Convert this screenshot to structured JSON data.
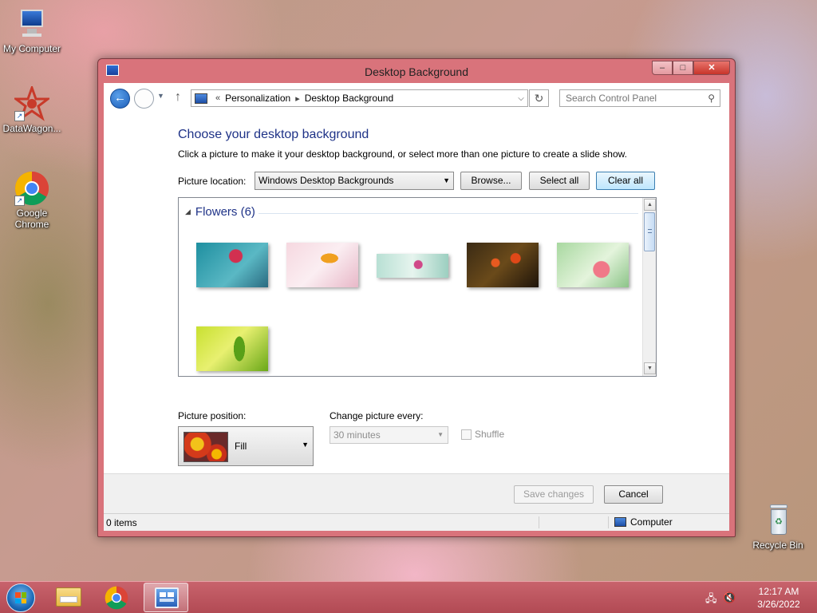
{
  "desktop": {
    "icons": [
      {
        "label": "My Computer",
        "icon": "computer-icon"
      },
      {
        "label": "DataWagon...",
        "icon": "datawagon-icon"
      },
      {
        "label": "Google Chrome",
        "icon": "chrome-icon"
      },
      {
        "label": "Recycle Bin",
        "icon": "recycle-bin-icon"
      }
    ]
  },
  "window": {
    "title": "Desktop Background",
    "controls": {
      "minimize": "‒",
      "maximize": "□",
      "close": "✕"
    }
  },
  "nav": {
    "breadcrumb_prefix": "«",
    "breadcrumbs": [
      "Personalization",
      "Desktop Background"
    ],
    "search_placeholder": "Search Control Panel"
  },
  "content": {
    "heading": "Choose your desktop background",
    "subtext": "Click a picture to make it your desktop background, or select more than one picture to create a slide show.",
    "picture_location_label": "Picture location:",
    "picture_location_value": "Windows Desktop Backgrounds",
    "browse_label": "Browse...",
    "select_all_label": "Select all",
    "clear_all_label": "Clear all",
    "group_name": "Flowers (6)",
    "thumbnails": [
      {
        "name": "flower-1",
        "colors": [
          "#1e8fa0",
          "#d23050"
        ]
      },
      {
        "name": "flower-2",
        "colors": [
          "#f6d8e0",
          "#f0a020"
        ]
      },
      {
        "name": "flower-3",
        "colors": [
          "#b8e0d4",
          "#d04888"
        ]
      },
      {
        "name": "flower-4",
        "colors": [
          "#3a2a14",
          "#e04818"
        ]
      },
      {
        "name": "flower-5",
        "colors": [
          "#a8d8a0",
          "#f07888"
        ]
      },
      {
        "name": "flower-6",
        "colors": [
          "#c8e030",
          "#58a018"
        ]
      }
    ],
    "picture_position_label": "Picture position:",
    "picture_position_value": "Fill",
    "change_picture_label": "Change picture every:",
    "change_picture_value": "30 minutes",
    "shuffle_label": "Shuffle",
    "save_label": "Save changes",
    "cancel_label": "Cancel"
  },
  "statusbar": {
    "items_count": "0 items",
    "zone": "Computer"
  },
  "taskbar": {
    "time": "12:17 AM",
    "date": "3/26/2022",
    "apps": [
      "file-explorer-icon",
      "chrome-icon",
      "control-panel-icon"
    ]
  }
}
